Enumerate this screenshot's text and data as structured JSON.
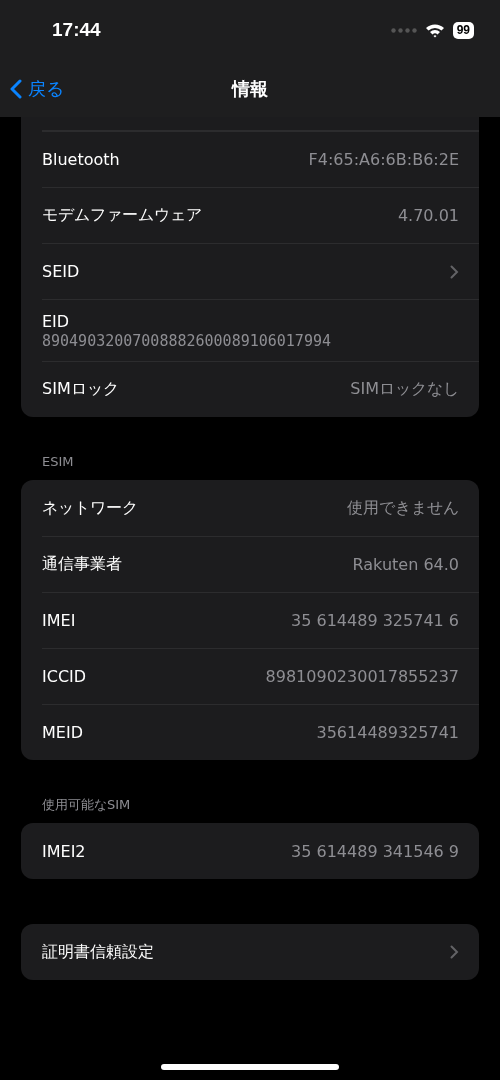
{
  "status_bar": {
    "time": "17:44",
    "battery": "99"
  },
  "nav": {
    "back": "戻る",
    "title": "情報"
  },
  "sections": [
    {
      "cut_top": true,
      "rows": [
        {
          "kind": "value",
          "label": "Bluetooth",
          "value": "F4:65:A6:6B:B6:2E"
        },
        {
          "kind": "value",
          "label": "モデムファームウェア",
          "value": "4.70.01"
        },
        {
          "kind": "link",
          "label": "SEID"
        },
        {
          "kind": "stacked",
          "label": "EID",
          "value": "89049032007008882600089106017994"
        },
        {
          "kind": "value",
          "label": "SIMロック",
          "value": "SIMロックなし"
        }
      ]
    },
    {
      "header": "ESIM",
      "rows": [
        {
          "kind": "value",
          "label": "ネットワーク",
          "value": "使用できません"
        },
        {
          "kind": "value",
          "label": "通信事業者",
          "value": "Rakuten 64.0"
        },
        {
          "kind": "value",
          "label": "IMEI",
          "value": "35 614489 325741 6"
        },
        {
          "kind": "value",
          "label": "ICCID",
          "value": "8981090230017855237"
        },
        {
          "kind": "value",
          "label": "MEID",
          "value": "35614489325741"
        }
      ]
    },
    {
      "header": "使用可能なSIM",
      "rows": [
        {
          "kind": "value",
          "label": "IMEI2",
          "value": "35 614489 341546 9"
        }
      ]
    },
    {
      "rows": [
        {
          "kind": "link",
          "label": "証明書信頼設定"
        }
      ]
    }
  ]
}
